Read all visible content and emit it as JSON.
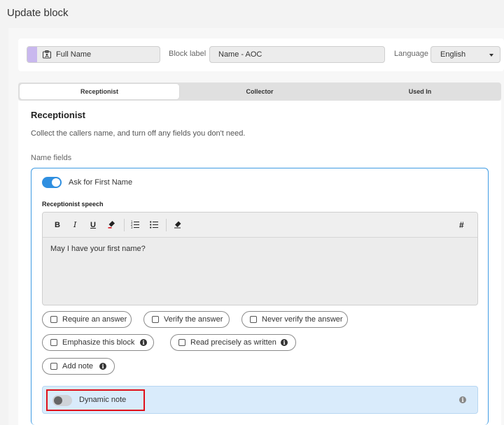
{
  "page": {
    "title": "Update block"
  },
  "block": {
    "type_label": "Full Name",
    "block_label_caption": "Block label",
    "block_label_value": "Name - AOC",
    "language_caption": "Language",
    "language_value": "English"
  },
  "tabs": [
    {
      "label": "Receptionist",
      "active": true
    },
    {
      "label": "Collector",
      "active": false
    },
    {
      "label": "Used In",
      "active": false
    }
  ],
  "section": {
    "title": "Receptionist",
    "description": "Collect the callers name, and turn off any fields you don't need.",
    "name_fields_label": "Name fields"
  },
  "first_name": {
    "toggle_on": true,
    "label": "Ask for First Name",
    "speech_label": "Receptionist speech",
    "speech_text": "May I have your first name?"
  },
  "toolbar": {
    "bold": "B",
    "italic": "I",
    "underline": "U",
    "hash": "#"
  },
  "options": [
    {
      "label": "Require an answer",
      "checked": false
    },
    {
      "label": "Verify the answer",
      "checked": false
    },
    {
      "label": "Never verify the answer",
      "checked": false
    },
    {
      "label": "Emphasize this block",
      "checked": false,
      "info": true
    },
    {
      "label": "Read precisely as written",
      "checked": false,
      "info": true
    },
    {
      "label": "Add note",
      "checked": false,
      "info": true
    }
  ],
  "dynamic_note": {
    "label": "Dynamic note",
    "toggle_on": false
  },
  "colors": {
    "accent": "#2f8fe0",
    "type_accent": "#c9b8ee",
    "highlight": "#e0101a",
    "dyn_bg": "#d9ebfb"
  }
}
